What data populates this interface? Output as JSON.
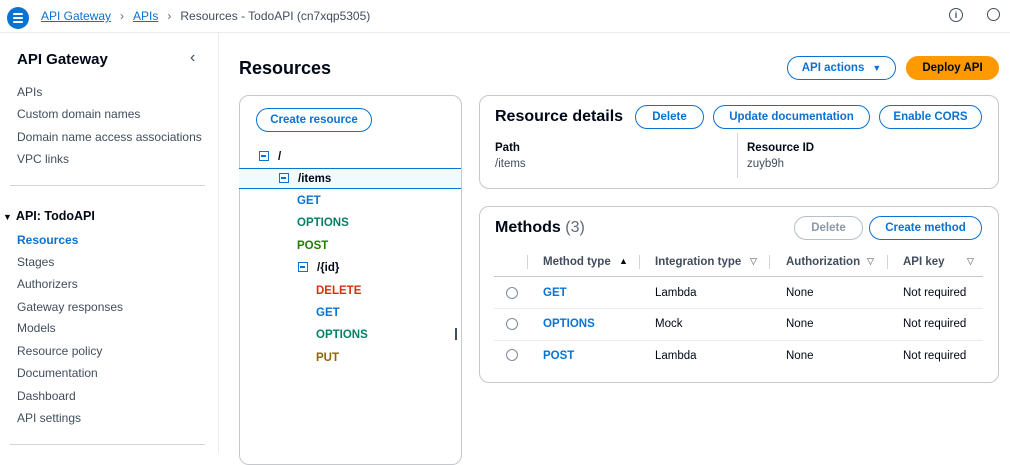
{
  "breadcrumb": {
    "items": [
      "API Gateway",
      "APIs"
    ],
    "current": "Resources - TodoAPI (cn7xqp5305)"
  },
  "sidebar": {
    "title": "API Gateway",
    "items": [
      "APIs",
      "Custom domain names",
      "Domain name access associations",
      "VPC links"
    ],
    "group_title": "API: TodoAPI",
    "group_items": [
      "Resources",
      "Stages",
      "Authorizers",
      "Gateway responses",
      "Models",
      "Resource policy",
      "Documentation",
      "Dashboard",
      "API settings"
    ]
  },
  "page": {
    "title": "Resources",
    "api_actions_label": "API actions",
    "deploy_label": "Deploy API"
  },
  "tree": {
    "create_label": "Create resource",
    "root": "/",
    "items_path": "/items",
    "items_methods": [
      "GET",
      "OPTIONS",
      "POST"
    ],
    "id_path": "/{id}",
    "id_methods": [
      "DELETE",
      "GET",
      "OPTIONS",
      "PUT"
    ]
  },
  "details": {
    "title": "Resource details",
    "delete_label": "Delete",
    "update_doc_label": "Update documentation",
    "cors_label": "Enable CORS",
    "path_label": "Path",
    "path_value": "/items",
    "rid_label": "Resource ID",
    "rid_value": "zuyb9h"
  },
  "methods": {
    "title": "Methods",
    "count": "(3)",
    "delete_label": "Delete",
    "create_label": "Create method",
    "columns": [
      "Method type",
      "Integration type",
      "Authorization",
      "API key"
    ],
    "rows": [
      {
        "method": "GET",
        "integration": "Lambda",
        "auth": "None",
        "apikey": "Not required"
      },
      {
        "method": "OPTIONS",
        "integration": "Mock",
        "auth": "None",
        "apikey": "Not required"
      },
      {
        "method": "POST",
        "integration": "Lambda",
        "auth": "None",
        "apikey": "Not required"
      }
    ]
  },
  "colors": {
    "accent": "#0972d3",
    "primary_button": "#ff9900",
    "delete_method": "#d13212",
    "options_method": "#067f68",
    "post_method": "#1d8102",
    "put_method": "#8d6605"
  }
}
